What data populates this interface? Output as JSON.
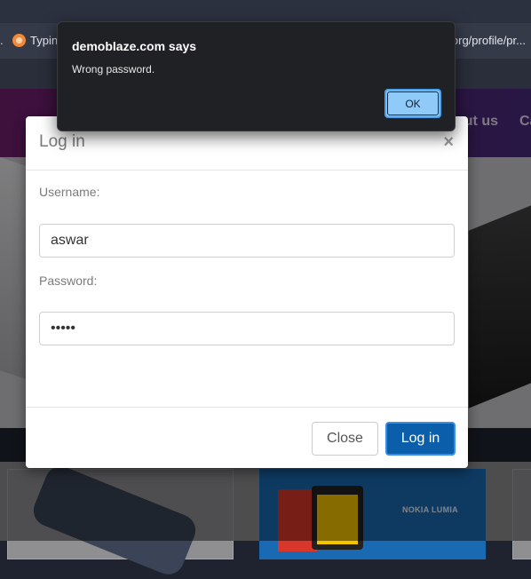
{
  "browser": {
    "bookmark_left_fragment": ".",
    "bookmark_label": "Typin",
    "bookmark_right_fragment": "org/profile/pr..."
  },
  "site_nav": {
    "about_label": "out us",
    "cart_label": "Ca"
  },
  "products": {
    "lumia_label": "NOKIA LUMIA"
  },
  "login_modal": {
    "title": "Log in",
    "close_symbol": "×",
    "username_label": "Username:",
    "username_value": "aswar",
    "password_label": "Password:",
    "password_value": "•••••",
    "close_button": "Close",
    "login_button": "Log in"
  },
  "alert": {
    "title": "demoblaze.com says",
    "message": "Wrong password.",
    "ok_button": "OK"
  },
  "colors": {
    "nav_gradient_start": "#731e6e",
    "primary_button": "#0b5eaa",
    "alert_background": "#202124",
    "alert_ok": "#8fcaf9"
  }
}
